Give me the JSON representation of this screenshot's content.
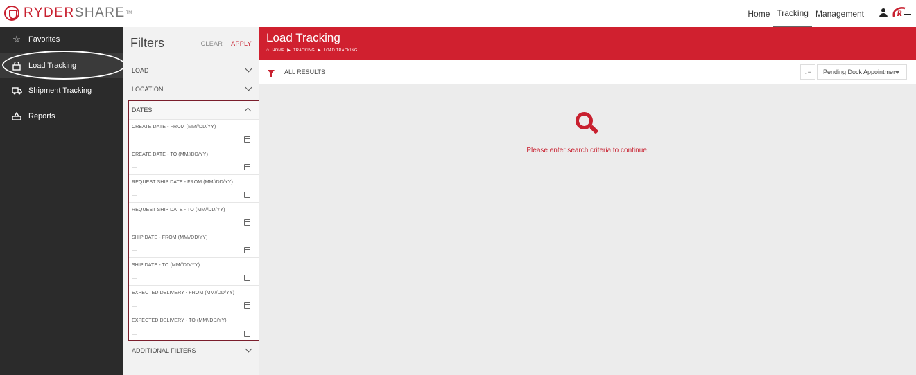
{
  "brand": {
    "part1": "RYDER",
    "part2": "SHARE",
    "tm": "TM"
  },
  "nav": {
    "home": "Home",
    "tracking": "Tracking",
    "management": "Management"
  },
  "sidebar": {
    "items": [
      {
        "label": "Favorites",
        "icon": "star-icon"
      },
      {
        "label": "Load Tracking",
        "icon": "lock-icon"
      },
      {
        "label": "Shipment Tracking",
        "icon": "truck-icon"
      },
      {
        "label": "Reports",
        "icon": "reports-icon"
      }
    ]
  },
  "filters": {
    "title": "Filters",
    "clear": "CLEAR",
    "apply": "APPLY",
    "sections": {
      "load": "LOAD",
      "location": "LOCATION",
      "dates": "DATES",
      "additional": "ADDITIONAL FILTERS"
    },
    "date_fields": [
      {
        "label": "CREATE DATE - FROM (MM//DD/YY)",
        "value": "—"
      },
      {
        "label": "CREATE DATE - TO (MM//DD/YY)",
        "value": "—"
      },
      {
        "label": "REQUEST SHIP DATE - FROM (MM//DD/YY)",
        "value": "—"
      },
      {
        "label": "REQUEST SHIP DATE - TO (MM//DD/YY)",
        "value": "—"
      },
      {
        "label": "SHIP DATE - FROM (MM//DD/YY)",
        "value": "—"
      },
      {
        "label": "SHIP DATE - TO (MM//DD/YY)",
        "value": "—"
      },
      {
        "label": "EXPECTED DELIVERY - FROM (MM//DD/YY)",
        "value": "—"
      },
      {
        "label": "EXPECTED DELIVERY - TO (MM//DD/YY)",
        "value": "—"
      }
    ]
  },
  "main": {
    "title": "Load Tracking",
    "breadcrumb": [
      "HOME",
      "TRACKING",
      "LOAD TRACKING"
    ],
    "results_label": "ALL RESULTS",
    "sort_selected": "Pending Dock Appointmer",
    "empty_message": "Please enter search criteria to continue."
  },
  "colors": {
    "accent": "#d0202f",
    "sidebar": "#2b2b2b",
    "highlight_border": "#7b1e2c"
  }
}
